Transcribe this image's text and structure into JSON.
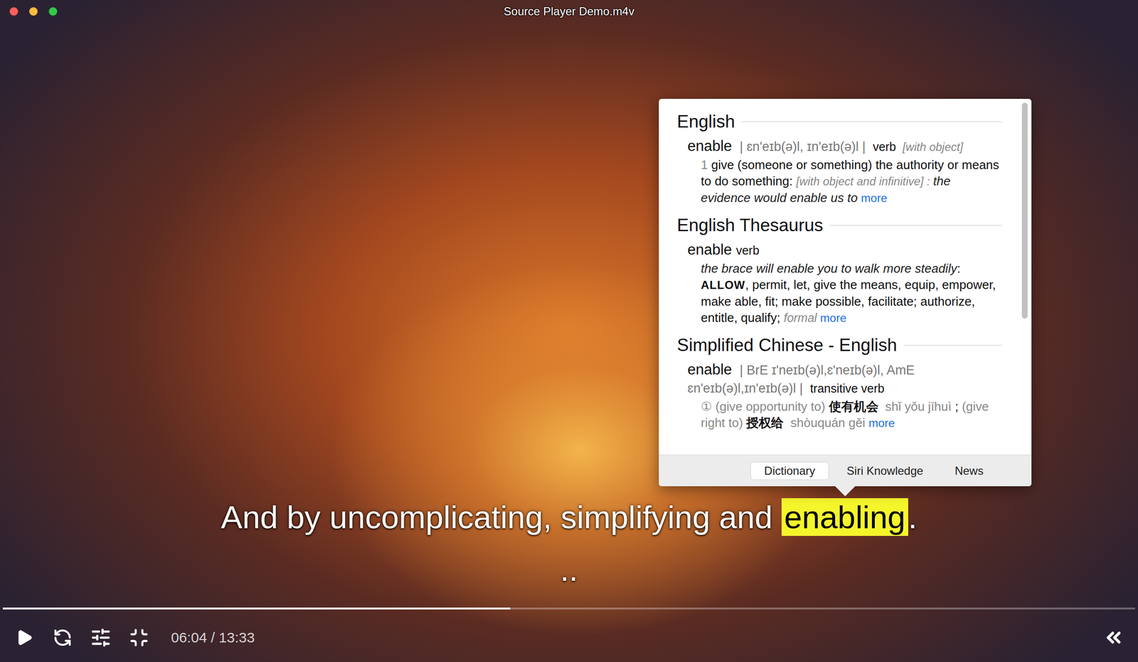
{
  "window": {
    "title": "Source Player Demo.m4v"
  },
  "dictionary": {
    "sections": [
      {
        "title": "English",
        "head": [
          {
            "text": "enable ",
            "style": "headword"
          },
          {
            "text": " | ɛn'eɪb(ə)l, ɪn'eɪb(ə)l |  ",
            "style": "pron"
          },
          {
            "text": "verb ",
            "style": "pos"
          },
          {
            "text": " [with object]",
            "style": "grammar"
          }
        ],
        "body": [
          {
            "text": "1 ",
            "style": "num"
          },
          {
            "text": "give (someone or something) the authority or means to do something: ",
            "style": "plain"
          },
          {
            "text": "[with object and infinitive] : ",
            "style": "grammar"
          },
          {
            "text": "the evidence would enable us to ",
            "style": "example"
          },
          {
            "text": "more",
            "style": "link"
          }
        ]
      },
      {
        "title": "English Thesaurus",
        "head": [
          {
            "text": "enable ",
            "style": "headword"
          },
          {
            "text": "verb",
            "style": "pos"
          }
        ],
        "body": [
          {
            "text": "the brace will enable you to walk more steadily",
            "style": "example"
          },
          {
            "text": ": ",
            "style": "plain"
          },
          {
            "text": "ALLOW",
            "style": "caps"
          },
          {
            "text": ", permit, let, give the means, equip, empower, make able, fit; make possible, facilitate; authorize, entitle, qualify; ",
            "style": "plain"
          },
          {
            "text": "formal ",
            "style": "label"
          },
          {
            "text": "more",
            "style": "link"
          }
        ]
      },
      {
        "title": "Simplified Chinese - English",
        "head": [
          {
            "text": "enable ",
            "style": "headword"
          },
          {
            "text": " | BrE ɪ'neɪb(ə)l,ɛ'neɪb(ə)l, AmE ɛn'eɪb(ə)l,ɪn'eɪb(ə)l |  ",
            "style": "pron"
          },
          {
            "text": "transitive verb",
            "style": "pos"
          }
        ],
        "body": [
          {
            "text": "① ",
            "style": "num"
          },
          {
            "text": "(give opportunity to) ",
            "style": "gloss"
          },
          {
            "text": "使有机会 ",
            "style": "chinese"
          },
          {
            "text": " shǐ yǒu jīhuì ",
            "style": "gloss"
          },
          {
            "text": "; ",
            "style": "plain"
          },
          {
            "text": "(give right to) ",
            "style": "gloss"
          },
          {
            "text": "授权给 ",
            "style": "chinese"
          },
          {
            "text": " shòuquán gěi ",
            "style": "gloss"
          },
          {
            "text": "more",
            "style": "link"
          }
        ]
      }
    ],
    "scroll_thumb": {
      "level": 0.78
    },
    "tabs": [
      {
        "label": "Dictionary",
        "selected": true
      },
      {
        "label": "Siri Knowledge",
        "selected": false
      },
      {
        "label": "News",
        "selected": false
      }
    ]
  },
  "subtitles": {
    "lines": [
      [
        {
          "text": "And by uncomplicating, simplifying and ",
          "highlighted": false
        },
        {
          "text": "enabling",
          "highlighted": true
        },
        {
          "text": ".",
          "highlighted": false
        }
      ],
      [
        {
          "text": "..",
          "highlighted": false
        }
      ]
    ]
  },
  "controls": {
    "playing": false,
    "progress": {
      "level": 0.448
    },
    "time": "06:04 / 13:33"
  }
}
